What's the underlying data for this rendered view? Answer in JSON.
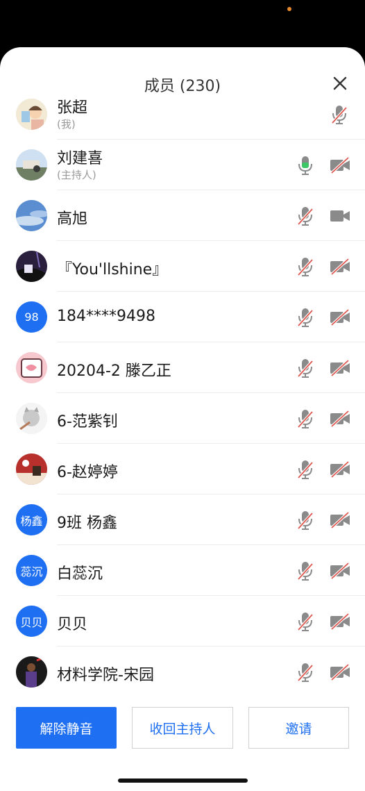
{
  "header": {
    "title": "成员 (230)"
  },
  "members": [
    {
      "name": "张超",
      "sub": "(我)",
      "mic": "muted",
      "cam": "none"
    },
    {
      "name": "刘建喜",
      "sub": "(主持人)",
      "mic": "active",
      "cam": "off"
    },
    {
      "name": "高旭",
      "sub": "",
      "mic": "muted",
      "cam": "on"
    },
    {
      "name": "『You'llshine』",
      "sub": "",
      "mic": "muted",
      "cam": "off"
    },
    {
      "name": "184****9498",
      "sub": "",
      "avatar_text": "98",
      "mic": "muted",
      "cam": "off"
    },
    {
      "name": "20204-2 滕乙正",
      "sub": "",
      "mic": "muted",
      "cam": "off"
    },
    {
      "name": "6-范紫钊",
      "sub": "",
      "mic": "muted",
      "cam": "off"
    },
    {
      "name": "6-赵婷婷",
      "sub": "",
      "mic": "muted",
      "cam": "off"
    },
    {
      "name": "9班 杨鑫",
      "sub": "",
      "avatar_text": "杨鑫",
      "mic": "muted",
      "cam": "off"
    },
    {
      "name": "白蕊沉",
      "sub": "",
      "avatar_text": "蕊沉",
      "mic": "muted",
      "cam": "off"
    },
    {
      "name": "贝贝",
      "sub": "",
      "avatar_text": "贝贝",
      "mic": "muted",
      "cam": "off"
    },
    {
      "name": "材料学院-宋园",
      "sub": "",
      "mic": "muted",
      "cam": "off"
    }
  ],
  "actions": {
    "unmute": "解除静音",
    "reclaim_host": "收回主持人",
    "invite": "邀请"
  },
  "colors": {
    "accent": "#1e6ff1",
    "muted_slash": "#e0574f",
    "mic_active": "#3dc765",
    "icon_gray": "#8a8a8a"
  }
}
